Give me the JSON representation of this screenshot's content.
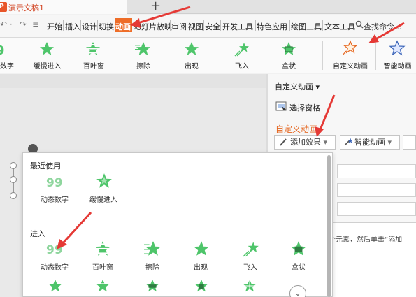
{
  "titlebar": {
    "doc_title": "演示文稿1",
    "logo": "P",
    "new_tab": "+"
  },
  "quick_access": {
    "undo": "↶ ·",
    "redo": "↷",
    "more": "≡"
  },
  "menu": {
    "tabs": [
      "开始",
      "插入",
      "设计",
      "切换",
      "动画",
      "幻灯片放映",
      "审阅",
      "视图",
      "安全",
      "开发工具",
      "特色应用",
      "绘图工具",
      "文本工具"
    ],
    "active": "动画",
    "search": "查找命令..."
  },
  "ribbon": {
    "effects": [
      "数字",
      "缓慢进入",
      "百叶窗",
      "擦除",
      "出现",
      "飞入",
      "盒状"
    ],
    "custom_anim": "自定义动画",
    "smart_anim": "智能动画"
  },
  "pane": {
    "header": "自定义动画",
    "select_pane": "选择窗格",
    "title": "自定义动画",
    "add_effect": "添加效果",
    "smart_anim": "智能动画",
    "hint": "个元素，然后单击“添加"
  },
  "dropdown": {
    "recent_title": "最近使用",
    "recent_items": [
      "动态数字",
      "缓慢进入"
    ],
    "enter_title": "进入",
    "enter_items": [
      "动态数字",
      "百叶窗",
      "擦除",
      "出现",
      "飞入",
      "盒状"
    ],
    "more": "⌄"
  },
  "colors": {
    "accent": "#ee6d28",
    "star": "#4ec56a",
    "arrow": "#e53935",
    "title_orange": "#e5651e"
  }
}
